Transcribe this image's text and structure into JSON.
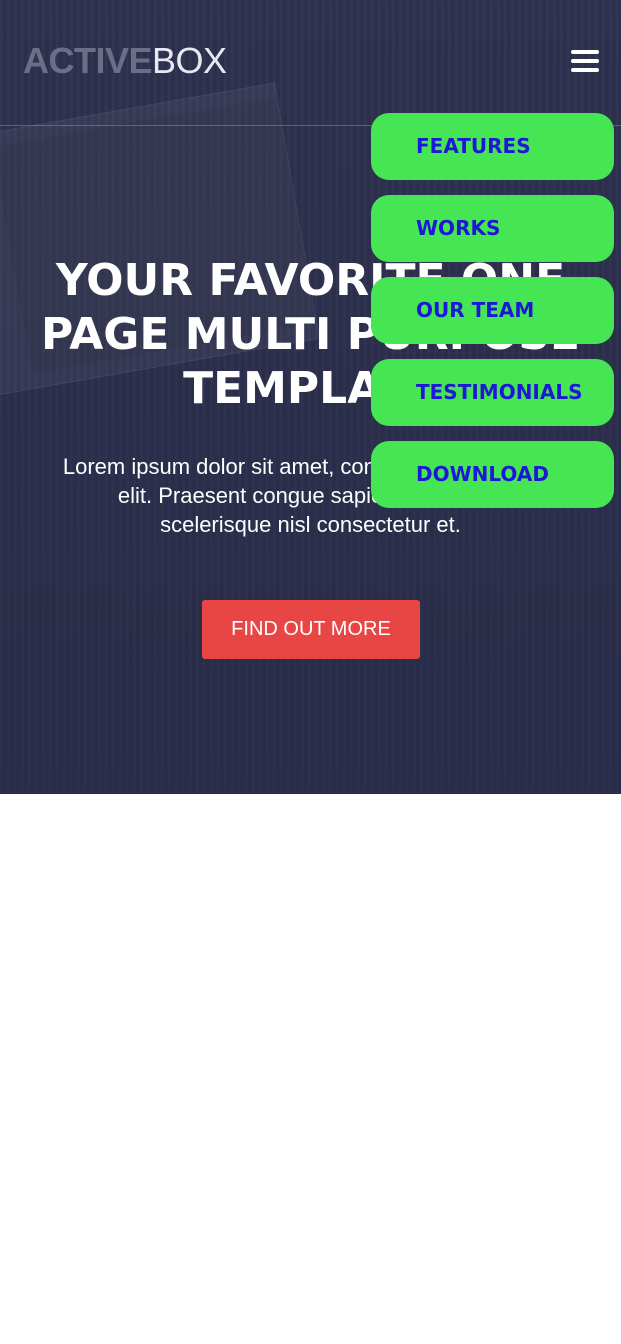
{
  "header": {
    "logo_strong": "ACTIVE",
    "logo_light": "BOX"
  },
  "hero": {
    "title": "YOUR FAVORITE ONE PAGE MULTI PURPOSE TEMPLATE",
    "text": "Lorem ipsum dolor sit amet, consectetur adipiscing elit. Praesent congue sapien magna vel scelerisque nisl consectetur et.",
    "cta_label": "FIND OUT MORE"
  },
  "nav": {
    "items": [
      {
        "label": "FEATURES"
      },
      {
        "label": "WORKS"
      },
      {
        "label": "OUR TEAM"
      },
      {
        "label": "TESTIMONIALS"
      },
      {
        "label": "DOWNLOAD"
      }
    ]
  },
  "icons": {
    "menu": "hamburger-menu-icon"
  },
  "colors": {
    "hero_bg": "#2f3350",
    "cta": "#e84545",
    "nav_item_bg": "#45e553",
    "nav_item_text": "#1d18d8"
  }
}
